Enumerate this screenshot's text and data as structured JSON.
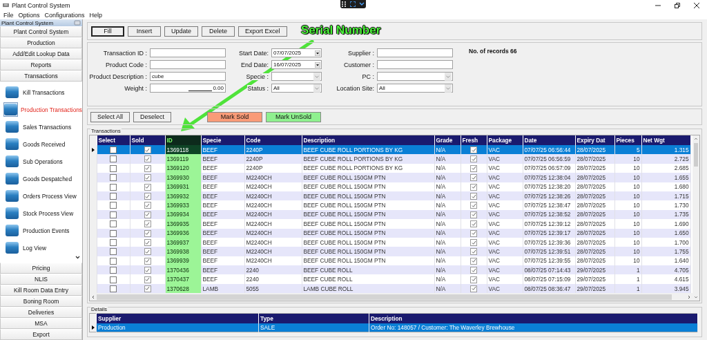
{
  "window": {
    "title": "Plant Control System"
  },
  "menu": [
    "File",
    "Options",
    "Configurations",
    "Help"
  ],
  "sidebar": {
    "title": "Plant Control System",
    "top_sections": [
      "Plant Control System",
      "Production",
      "Add/Edit Lookup Data",
      "Reports",
      "Transactions"
    ],
    "items": [
      {
        "label": "Kill Transactions",
        "selected": false
      },
      {
        "label": "Production Transactions",
        "selected": true
      },
      {
        "label": "Sales Transactions",
        "selected": false
      },
      {
        "label": "Goods Received",
        "selected": false
      },
      {
        "label": "Sub Operations",
        "selected": false
      },
      {
        "label": "Goods Despatched",
        "selected": false
      },
      {
        "label": "Orders Process View",
        "selected": false
      },
      {
        "label": "Stock Process View",
        "selected": false
      },
      {
        "label": "Production Events",
        "selected": false
      },
      {
        "label": "Log View",
        "selected": false
      }
    ],
    "bottom_sections": [
      "Pricing",
      "NLIS",
      "Kill Room Data Entry",
      "Boning Room",
      "Deliveries",
      "MSA",
      "Export"
    ]
  },
  "toolbar": [
    {
      "label": "Fill",
      "selected": true
    },
    {
      "label": "Insert",
      "selected": false
    },
    {
      "label": "Update",
      "selected": false
    },
    {
      "label": "Delete",
      "selected": false
    },
    {
      "label": "Export Excel",
      "selected": false
    }
  ],
  "filter_columns": [
    {
      "fields": [
        {
          "label": "Transaction ID :",
          "kind": "text"
        },
        {
          "label": "Product Code :",
          "kind": "text"
        },
        {
          "label": "Product Description :",
          "kind": "text",
          "value": "cube"
        },
        {
          "label": "Weight :",
          "kind": "number",
          "value": "0.00"
        }
      ]
    },
    {
      "fields": [
        {
          "label": "Start Date:",
          "kind": "date",
          "value": "07/07/2025"
        },
        {
          "label": "End Date:",
          "kind": "date",
          "value": "16/07/2025"
        },
        {
          "label": "Specie :",
          "kind": "combo"
        },
        {
          "label": "Status :",
          "kind": "combo",
          "value": "All"
        }
      ]
    },
    {
      "fields": [
        {
          "label": "Supplier :",
          "kind": "text"
        },
        {
          "label": "Customer :",
          "kind": "text"
        },
        {
          "label": "PC :",
          "kind": "combo"
        },
        {
          "label": "Location Site:",
          "kind": "combo",
          "value": "All"
        }
      ]
    }
  ],
  "records_label": "No. of records 66",
  "selection_buttons": [
    "Select All",
    "Deselect"
  ],
  "mark_buttons": [
    {
      "label": "Mark Sold",
      "color": "#f99b78"
    },
    {
      "label": "Mark UnSold",
      "color": "#8ff08f"
    }
  ],
  "transactions": {
    "title": "Transactions",
    "columns": [
      {
        "label": "Select",
        "kind": "check",
        "highlighted": false
      },
      {
        "label": "Sold",
        "kind": "check",
        "highlighted": false
      },
      {
        "label": "ID",
        "kind": "text",
        "highlighted": true
      },
      {
        "label": "Specie",
        "kind": "text",
        "highlighted": false
      },
      {
        "label": "Code",
        "kind": "text",
        "highlighted": false
      },
      {
        "label": "Description",
        "kind": "text",
        "highlighted": false
      },
      {
        "label": "Grade",
        "kind": "text",
        "highlighted": false
      },
      {
        "label": "Fresh",
        "kind": "check",
        "highlighted": false
      },
      {
        "label": "Package",
        "kind": "text",
        "highlighted": false
      },
      {
        "label": "Date",
        "kind": "text",
        "highlighted": false
      },
      {
        "label": "Expiry Dat",
        "kind": "text",
        "highlighted": false
      },
      {
        "label": "Pieces",
        "kind": "number",
        "highlighted": false
      },
      {
        "label": "Net Wgt",
        "kind": "number",
        "highlighted": false
      }
    ],
    "rows": [
      {
        "selected": true,
        "cells": [
          false,
          true,
          "1369118",
          "BEEF",
          "2240P",
          "BEEF CUBE ROLL PORTIONS BY KG",
          "N/A",
          true,
          "VAC",
          "07/07/25 06:56:44",
          "28/07/2025",
          "5",
          "1.315"
        ]
      },
      {
        "selected": false,
        "cells": [
          false,
          true,
          "1369119",
          "BEEF",
          "2240P",
          "BEEF CUBE ROLL PORTIONS BY KG",
          "N/A",
          true,
          "VAC",
          "07/07/25 06:56:59",
          "28/07/2025",
          "10",
          "2.725"
        ]
      },
      {
        "selected": false,
        "cells": [
          false,
          true,
          "1369120",
          "BEEF",
          "2240P",
          "BEEF CUBE ROLL PORTIONS BY KG",
          "N/A",
          true,
          "VAC",
          "07/07/25 06:57:09",
          "28/07/2025",
          "10",
          "2.685"
        ]
      },
      {
        "selected": false,
        "cells": [
          false,
          true,
          "1369930",
          "BEEF",
          "M2240CH",
          "BEEF CUBE ROLL 150GM PTN",
          "N/A",
          true,
          "VAC",
          "07/07/25 12:38:04",
          "28/07/2025",
          "10",
          "1.655"
        ]
      },
      {
        "selected": false,
        "cells": [
          false,
          true,
          "1369931",
          "BEEF",
          "M2240CH",
          "BEEF CUBE ROLL 150GM PTN",
          "N/A",
          true,
          "VAC",
          "07/07/25 12:38:20",
          "28/07/2025",
          "10",
          "1.680"
        ]
      },
      {
        "selected": false,
        "cells": [
          false,
          true,
          "1369932",
          "BEEF",
          "M2240CH",
          "BEEF CUBE ROLL 150GM PTN",
          "N/A",
          true,
          "VAC",
          "07/07/25 12:38:26",
          "28/07/2025",
          "10",
          "1.715"
        ]
      },
      {
        "selected": false,
        "cells": [
          false,
          true,
          "1369933",
          "BEEF",
          "M2240CH",
          "BEEF CUBE ROLL 150GM PTN",
          "N/A",
          true,
          "VAC",
          "07/07/25 12:38:47",
          "28/07/2025",
          "10",
          "1.730"
        ]
      },
      {
        "selected": false,
        "cells": [
          false,
          true,
          "1369934",
          "BEEF",
          "M2240CH",
          "BEEF CUBE ROLL 150GM PTN",
          "N/A",
          true,
          "VAC",
          "07/07/25 12:38:52",
          "28/07/2025",
          "10",
          "1.735"
        ]
      },
      {
        "selected": false,
        "cells": [
          false,
          true,
          "1369935",
          "BEEF",
          "M2240CH",
          "BEEF CUBE ROLL 150GM PTN",
          "N/A",
          true,
          "VAC",
          "07/07/25 12:39:12",
          "28/07/2025",
          "10",
          "1.690"
        ]
      },
      {
        "selected": false,
        "cells": [
          false,
          true,
          "1369936",
          "BEEF",
          "M2240CH",
          "BEEF CUBE ROLL 150GM PTN",
          "N/A",
          true,
          "VAC",
          "07/07/25 12:39:17",
          "28/07/2025",
          "10",
          "1.650"
        ]
      },
      {
        "selected": false,
        "cells": [
          false,
          true,
          "1369937",
          "BEEF",
          "M2240CH",
          "BEEF CUBE ROLL 150GM PTN",
          "N/A",
          true,
          "VAC",
          "07/07/25 12:39:36",
          "28/07/2025",
          "10",
          "1.700"
        ]
      },
      {
        "selected": false,
        "cells": [
          false,
          true,
          "1369938",
          "BEEF",
          "M2240CH",
          "BEEF CUBE ROLL 150GM PTN",
          "N/A",
          true,
          "VAC",
          "07/07/25 12:39:51",
          "28/07/2025",
          "10",
          "1.755"
        ]
      },
      {
        "selected": false,
        "cells": [
          false,
          true,
          "1369939",
          "BEEF",
          "M2240CH",
          "BEEF CUBE ROLL 150GM PTN",
          "N/A",
          true,
          "VAC",
          "07/07/25 12:39:55",
          "28/07/2025",
          "10",
          "1.640"
        ]
      },
      {
        "selected": false,
        "cells": [
          false,
          true,
          "1370436",
          "BEEF",
          "2240",
          "BEEF CUBE ROLL",
          "N/A",
          true,
          "VAC",
          "08/07/25 07:14:43",
          "29/07/2025",
          "1",
          "4.705"
        ]
      },
      {
        "selected": false,
        "cells": [
          false,
          true,
          "1370437",
          "BEEF",
          "2240",
          "BEEF CUBE ROLL",
          "N/A",
          true,
          "VAC",
          "08/07/25 07:15:09",
          "29/07/2025",
          "1",
          "4.615"
        ]
      },
      {
        "selected": false,
        "cells": [
          false,
          true,
          "1370628",
          "LAMB",
          "5055",
          "LAMB CUBE ROLL",
          "N/A",
          true,
          "VAC",
          "08/07/25 08:36:47",
          "29/07/2025",
          "1",
          "3.945"
        ]
      }
    ]
  },
  "details": {
    "title": "Details",
    "columns": [
      "Supplier",
      "Type",
      "Description"
    ],
    "rows": [
      {
        "selected": true,
        "cells": [
          "Production",
          "SALE",
          "Order No: 148057 / Customer: The Waverley Brewhouse"
        ]
      }
    ]
  },
  "annotation": {
    "label": "Serial Number"
  }
}
